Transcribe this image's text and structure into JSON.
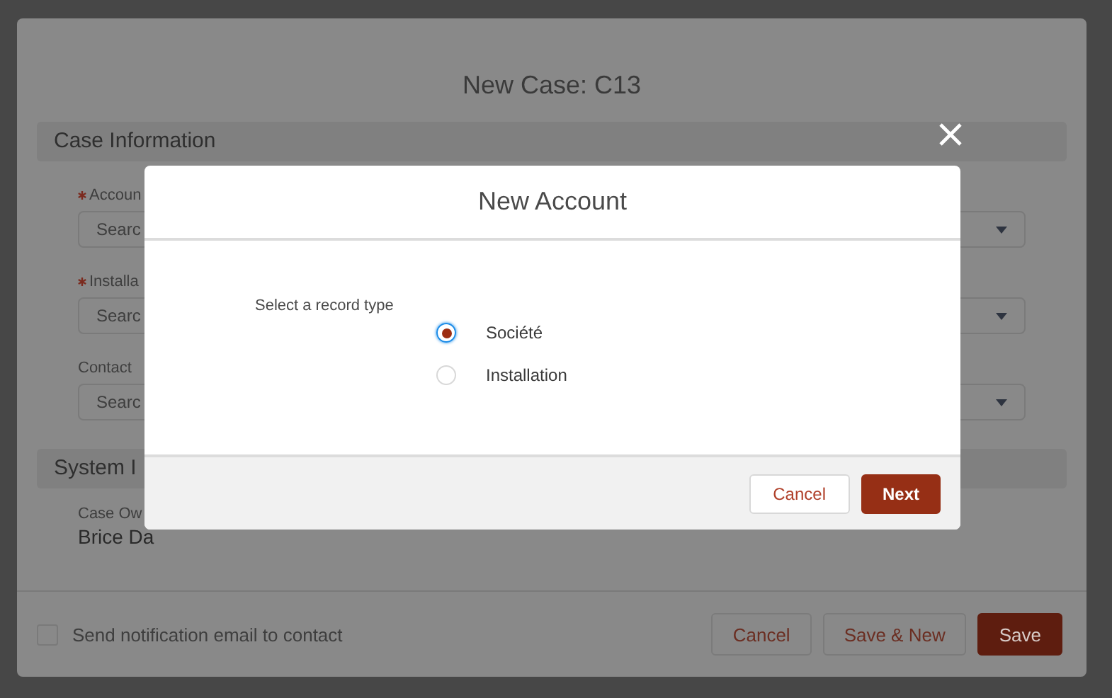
{
  "page": {
    "title": "New Case: C13",
    "sections": [
      {
        "title": "Case Information",
        "fields": [
          {
            "label": "Accoun",
            "required": true,
            "placeholder": "Searc"
          },
          {
            "label": "Installa",
            "required": true,
            "placeholder": "Searc"
          },
          {
            "label": "Contact",
            "required": false,
            "placeholder": "Searc"
          }
        ]
      },
      {
        "title": "System I",
        "owner_label": "Case Ow",
        "owner_value": "Brice Da"
      }
    ],
    "footer": {
      "checkbox": {
        "label": "Send notification email to contact",
        "checked": false
      },
      "buttons": [
        {
          "label": "Cancel",
          "kind": "neutral"
        },
        {
          "label": "Save & New",
          "kind": "neutral"
        },
        {
          "label": "Save",
          "kind": "brand"
        }
      ]
    }
  },
  "modal": {
    "title": "New Account",
    "prompt": "Select a record type",
    "options": [
      {
        "label": "Société",
        "selected": true
      },
      {
        "label": "Installation",
        "selected": false
      }
    ],
    "buttons": [
      {
        "label": "Cancel",
        "kind": "neutral"
      },
      {
        "label": "Next",
        "kind": "brand"
      }
    ]
  }
}
